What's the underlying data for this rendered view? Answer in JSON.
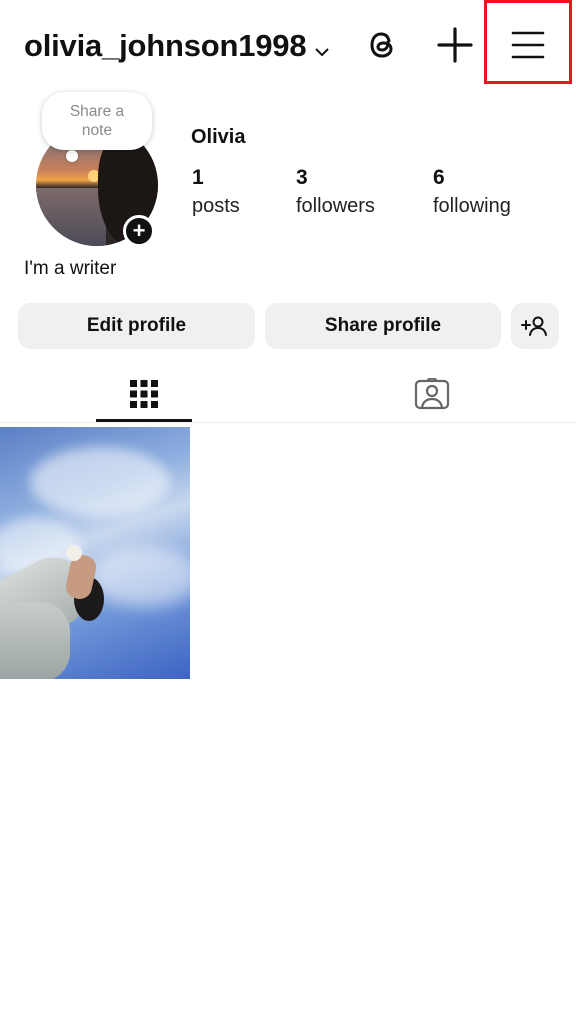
{
  "header": {
    "username": "olivia_johnson1998",
    "icons": {
      "switch_account": "chevron-down-icon",
      "threads": "threads-icon",
      "create": "plus-icon",
      "menu": "hamburger-menu-icon"
    },
    "highlight_color": "#e8141e"
  },
  "profile": {
    "note_placeholder": "Share a note",
    "display_name": "Olivia",
    "stats": {
      "posts": {
        "count": "1",
        "label": "posts"
      },
      "followers": {
        "count": "3",
        "label": "followers"
      },
      "following": {
        "count": "6",
        "label": "following"
      }
    },
    "bio": "I'm a writer"
  },
  "actions": {
    "edit_label": "Edit profile",
    "share_label": "Share profile",
    "discover_icon": "add-person-icon"
  },
  "tabs": [
    {
      "icon": "grid-icon",
      "active": true
    },
    {
      "icon": "tagged-person-icon",
      "active": false
    }
  ],
  "posts": [
    {
      "description": "photo"
    }
  ]
}
